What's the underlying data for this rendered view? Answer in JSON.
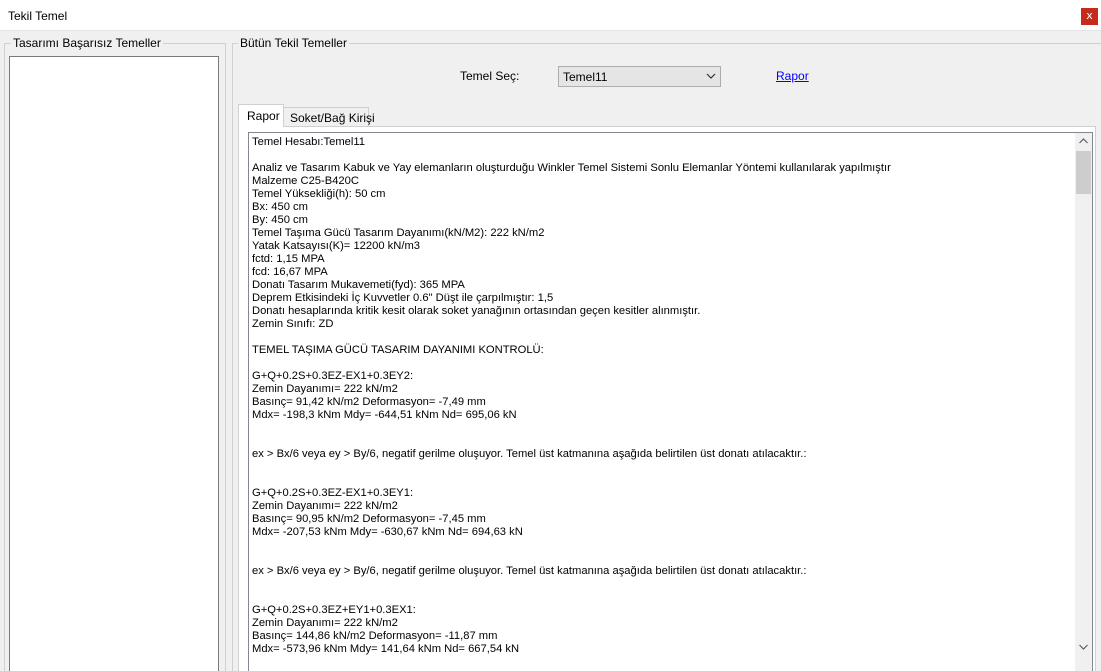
{
  "window": {
    "title": "Tekil Temel",
    "close_glyph": "x"
  },
  "left_panel": {
    "label": "Tasarımı Başarısız Temeller"
  },
  "right_panel": {
    "label": "Bütün Tekil Temeller",
    "select_label": "Temel Seç:",
    "select_value": "Temel11",
    "report_link": "Rapor"
  },
  "tabs": [
    {
      "label": "Rapor",
      "active": true
    },
    {
      "label": "Soket/Bağ Kirişi",
      "active": false
    }
  ],
  "report": {
    "lines": [
      "Temel Hesabı:Temel11",
      "",
      "Analiz ve Tasarım Kabuk ve Yay elemanların oluşturduğu Winkler Temel Sistemi Sonlu Elemanlar Yöntemi kullanılarak yapılmıştır",
      "Malzeme C25-B420C",
      "Temel Yüksekliği(h): 50 cm",
      "Bx: 450 cm",
      "By: 450 cm",
      "Temel Taşıma Gücü Tasarım Dayanımı(kN/M2): 222 kN/m2",
      "Yatak Katsayısı(K)= 12200 kN/m3",
      "fctd: 1,15 MPA",
      "fcd: 16,67 MPA",
      "Donatı Tasarım Mukavemeti(fyd): 365 MPA",
      "Deprem Etkisindeki İç Kuvvetler 0.6\" Düşt ile çarpılmıştır: 1,5",
      "Donatı hesaplarında kritik kesit olarak soket yanağının ortasından geçen kesitler alınmıştır.",
      "Zemin Sınıfı: ZD",
      "",
      "TEMEL TAŞIMA GÜCÜ TASARIM DAYANIMI KONTROLÜ:",
      "",
      "G+Q+0.2S+0.3EZ-EX1+0.3EY2:",
      "Zemin Dayanımı= 222 kN/m2",
      "Basınç= 91,42 kN/m2 Deformasyon= -7,49 mm",
      "Mdx= -198,3 kNm Mdy= -644,51 kNm Nd= 695,06 kN",
      "",
      "",
      "ex > Bx/6 veya ey > By/6, negatif gerilme oluşuyor. Temel üst katmanına aşağıda belirtilen üst donatı atılacaktır.:",
      "",
      "",
      "G+Q+0.2S+0.3EZ-EX1+0.3EY1:",
      "Zemin Dayanımı= 222 kN/m2",
      "Basınç= 90,95 kN/m2 Deformasyon= -7,45 mm",
      "Mdx= -207,53 kNm Mdy= -630,67 kNm Nd= 694,63 kN",
      "",
      "",
      "ex > Bx/6 veya ey > By/6, negatif gerilme oluşuyor. Temel üst katmanına aşağıda belirtilen üst donatı atılacaktır.:",
      "",
      "",
      "G+Q+0.2S+0.3EZ+EY1+0.3EX1:",
      "Zemin Dayanımı= 222 kN/m2",
      "Basınç= 144,86 kN/m2 Deformasyon= -11,87 mm",
      "Mdx= -573,96 kNm Mdy= 141,64 kNm Nd= 667,54 kN"
    ]
  },
  "colors": {
    "close_bg": "#c42b1c",
    "link": "#0000ff",
    "window_bg": "#f0f0f0"
  }
}
